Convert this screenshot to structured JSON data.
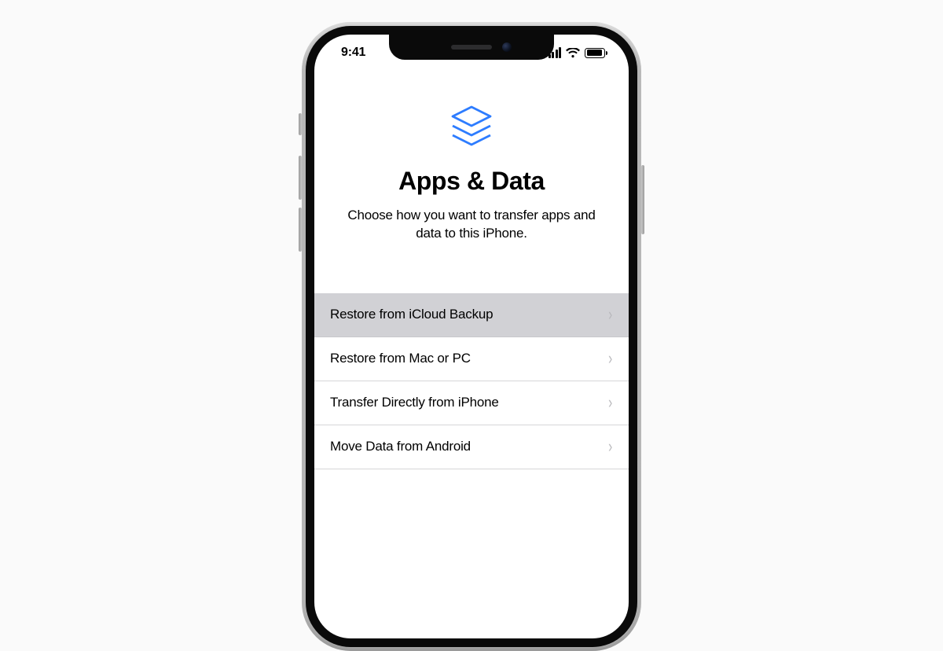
{
  "status": {
    "time": "9:41"
  },
  "screen": {
    "title": "Apps & Data",
    "subtitle": "Choose how you want to transfer apps and data to this iPhone."
  },
  "options": [
    {
      "label": "Restore from iCloud Backup",
      "selected": true
    },
    {
      "label": "Restore from Mac or PC",
      "selected": false
    },
    {
      "label": "Transfer Directly from iPhone",
      "selected": false
    },
    {
      "label": "Move Data from Android",
      "selected": false
    }
  ],
  "colors": {
    "accent": "#2d7cff"
  }
}
